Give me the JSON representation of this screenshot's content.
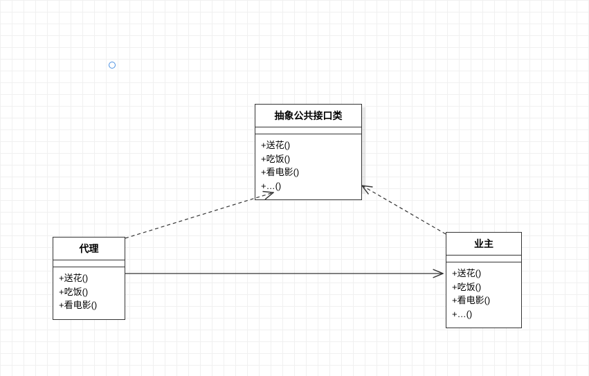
{
  "diagram": {
    "abstract": {
      "title": "抽象公共接口类",
      "methods": [
        "+送花()",
        "+吃饭()",
        "+看电影()",
        "+…()"
      ]
    },
    "proxy": {
      "title": "代理",
      "methods": [
        "+送花()",
        "+吃饭()",
        "+看电影()"
      ]
    },
    "owner": {
      "title": "业主",
      "methods": [
        "+送花()",
        "+吃饭()",
        "+看电影()",
        "+…()"
      ]
    }
  }
}
